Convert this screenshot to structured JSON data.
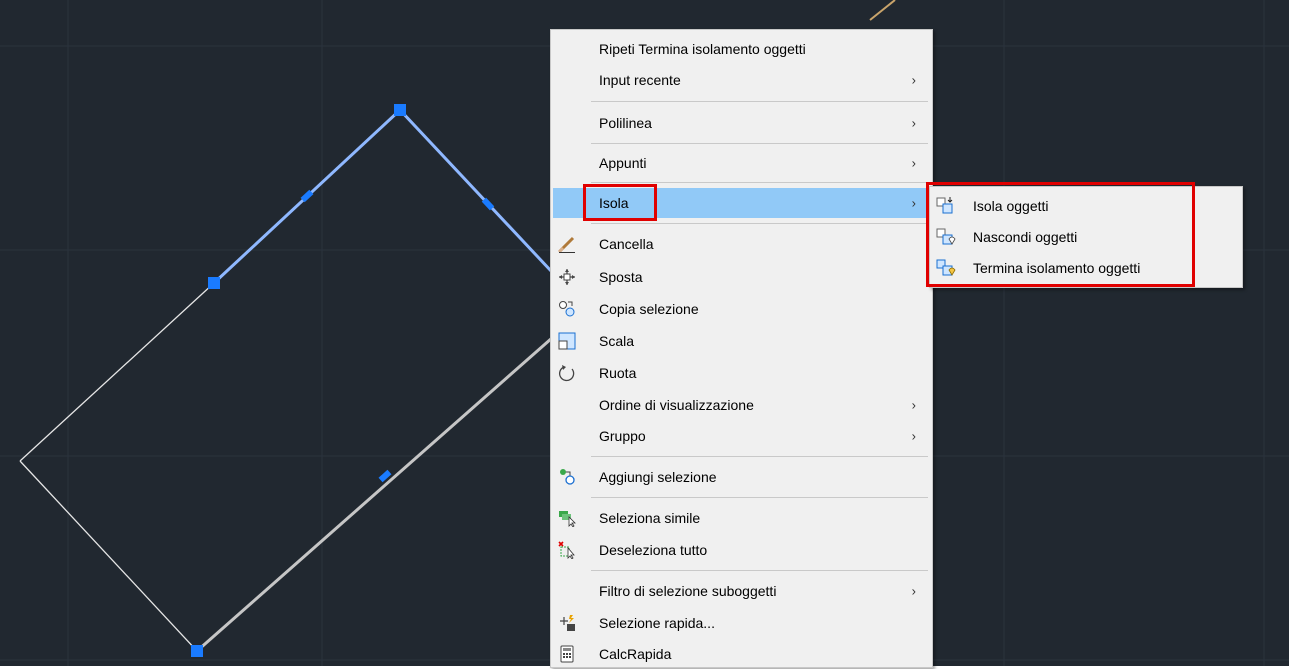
{
  "context_menu": {
    "items": [
      {
        "label": "Ripeti Termina isolamento oggetti",
        "has_submenu": false,
        "icon": ""
      },
      {
        "label": "Input recente",
        "has_submenu": true,
        "icon": ""
      },
      {
        "label": "Polilinea",
        "has_submenu": true,
        "icon": ""
      },
      {
        "label": "Appunti",
        "has_submenu": true,
        "icon": ""
      },
      {
        "label": "Isola",
        "has_submenu": true,
        "icon": "",
        "highlighted": true
      },
      {
        "label": "Cancella",
        "has_submenu": false,
        "icon": "eraser-icon"
      },
      {
        "label": "Sposta",
        "has_submenu": false,
        "icon": "move-icon"
      },
      {
        "label": "Copia selezione",
        "has_submenu": false,
        "icon": "copy-icon"
      },
      {
        "label": "Scala",
        "has_submenu": false,
        "icon": "scale-icon"
      },
      {
        "label": "Ruota",
        "has_submenu": false,
        "icon": "rotate-icon"
      },
      {
        "label": "Ordine di visualizzazione",
        "has_submenu": true,
        "icon": ""
      },
      {
        "label": "Gruppo",
        "has_submenu": true,
        "icon": ""
      },
      {
        "label": "Aggiungi selezione",
        "has_submenu": false,
        "icon": "add-selected-icon"
      },
      {
        "label": "Seleziona simile",
        "has_submenu": false,
        "icon": "select-similar-icon"
      },
      {
        "label": "Deseleziona tutto",
        "has_submenu": false,
        "icon": "deselect-all-icon"
      },
      {
        "label": "Filtro di selezione suboggetti",
        "has_submenu": true,
        "icon": ""
      },
      {
        "label": "Selezione rapida...",
        "has_submenu": false,
        "icon": "quick-select-icon"
      },
      {
        "label": "CalcRapida",
        "has_submenu": false,
        "icon": "calculator-icon"
      }
    ],
    "submenu_arrow": "›"
  },
  "isola_submenu": {
    "items": [
      {
        "label": "Isola oggetti",
        "icon": "isolate-objects-icon"
      },
      {
        "label": "Nascondi oggetti",
        "icon": "hide-objects-icon"
      },
      {
        "label": "Termina isolamento oggetti",
        "icon": "end-isolation-icon"
      }
    ]
  },
  "colors": {
    "canvas_background": "#212830",
    "menu_background": "#f0f0f0",
    "highlight": "#91c9f7",
    "callout_red": "#e00000",
    "selection_blue": "#1a7bff",
    "selected_line": "#8fb8ff",
    "white_line": "#e6e6e6",
    "orange_line": "#c9a46b"
  }
}
